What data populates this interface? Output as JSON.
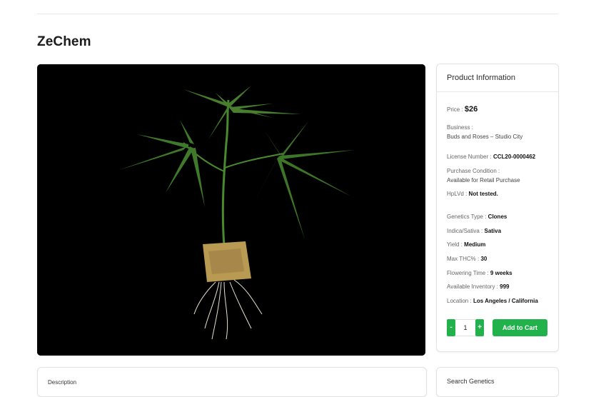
{
  "product": {
    "title": "ZeChem"
  },
  "info": {
    "header": "Product Information",
    "price_label": "Price :",
    "price_value": "$26",
    "business_label": "Business :",
    "business_value": "Buds and Roses – Studio City",
    "license_label": "License Number :",
    "license_value": "CCL20-0000462",
    "purchase_label": "Purchase Condition :",
    "purchase_value": "Available for Retail Purchase",
    "hplvd_label": "HpLVd :",
    "hplvd_value": "Not tested.",
    "genetics_label": "Genetics Type :",
    "genetics_value": "Clones",
    "indica_label": "Indica/Sativa :",
    "indica_value": "Sativa",
    "yield_label": "Yield :",
    "yield_value": "Medium",
    "thc_label": "Max THC% :",
    "thc_value": "30",
    "flowering_label": "Flowering Time :",
    "flowering_value": "9 weeks",
    "inventory_label": "Available Inventory :",
    "inventory_value": "999",
    "location_label": "Location :",
    "location_value": "Los Angeles / California"
  },
  "cart": {
    "minus_label": "-",
    "quantity": "1",
    "plus_label": "+",
    "add_label": "Add to Cart"
  },
  "description": {
    "label": "Description"
  },
  "search_genetics": {
    "label": "Search Genetics"
  },
  "colors": {
    "accent": "#22b24c",
    "leaf": "#3f7a2a",
    "image_bg": "#000000"
  }
}
